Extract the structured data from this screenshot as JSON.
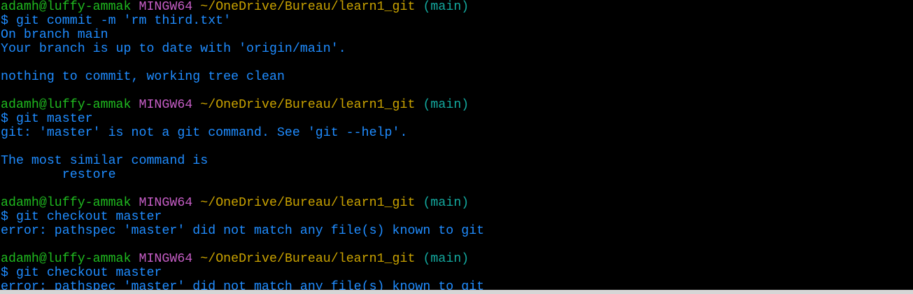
{
  "colors": {
    "green": "#1fb91f",
    "magenta": "#c55dc5",
    "yellow": "#c9a200",
    "cyan": "#13a89e",
    "blue": "#1f8cff",
    "background": "#000000"
  },
  "terminal": {
    "lines": [
      {
        "type": "prompt",
        "segments": [
          {
            "text": "adamh@luffy-ammak",
            "color": "green"
          },
          {
            "text": " "
          },
          {
            "text": "MINGW64",
            "color": "magenta"
          },
          {
            "text": " "
          },
          {
            "text": "~/OneDrive/Bureau/learn1_git",
            "color": "yellow"
          },
          {
            "text": " "
          },
          {
            "text": "(main)",
            "color": "cyan"
          }
        ]
      },
      {
        "type": "command",
        "segments": [
          {
            "text": "$ git commit -m 'rm third.txt'",
            "color": "blue"
          }
        ]
      },
      {
        "type": "output",
        "segments": [
          {
            "text": "On branch main",
            "color": "blue"
          }
        ]
      },
      {
        "type": "output",
        "segments": [
          {
            "text": "Your branch is up to date with 'origin/main'.",
            "color": "blue"
          }
        ]
      },
      {
        "type": "blank",
        "segments": []
      },
      {
        "type": "output",
        "segments": [
          {
            "text": "nothing to commit, working tree clean",
            "color": "blue"
          }
        ]
      },
      {
        "type": "blank",
        "segments": []
      },
      {
        "type": "prompt",
        "segments": [
          {
            "text": "adamh@luffy-ammak",
            "color": "green"
          },
          {
            "text": " "
          },
          {
            "text": "MINGW64",
            "color": "magenta"
          },
          {
            "text": " "
          },
          {
            "text": "~/OneDrive/Bureau/learn1_git",
            "color": "yellow"
          },
          {
            "text": " "
          },
          {
            "text": "(main)",
            "color": "cyan"
          }
        ]
      },
      {
        "type": "command",
        "segments": [
          {
            "text": "$ git master",
            "color": "blue"
          }
        ]
      },
      {
        "type": "output",
        "segments": [
          {
            "text": "git: 'master' is not a git command. See 'git --help'.",
            "color": "blue"
          }
        ]
      },
      {
        "type": "blank",
        "segments": []
      },
      {
        "type": "output",
        "segments": [
          {
            "text": "The most similar command is",
            "color": "blue"
          }
        ]
      },
      {
        "type": "output",
        "segments": [
          {
            "text": "        restore",
            "color": "blue"
          }
        ]
      },
      {
        "type": "blank",
        "segments": []
      },
      {
        "type": "prompt",
        "segments": [
          {
            "text": "adamh@luffy-ammak",
            "color": "green"
          },
          {
            "text": " "
          },
          {
            "text": "MINGW64",
            "color": "magenta"
          },
          {
            "text": " "
          },
          {
            "text": "~/OneDrive/Bureau/learn1_git",
            "color": "yellow"
          },
          {
            "text": " "
          },
          {
            "text": "(main)",
            "color": "cyan"
          }
        ]
      },
      {
        "type": "command",
        "segments": [
          {
            "text": "$ git checkout master",
            "color": "blue"
          }
        ]
      },
      {
        "type": "output",
        "segments": [
          {
            "text": "error: pathspec 'master' did not match any file(s) known to git",
            "color": "blue"
          }
        ]
      },
      {
        "type": "blank",
        "segments": []
      },
      {
        "type": "prompt",
        "segments": [
          {
            "text": "adamh@luffy-ammak",
            "color": "green"
          },
          {
            "text": " "
          },
          {
            "text": "MINGW64",
            "color": "magenta"
          },
          {
            "text": " "
          },
          {
            "text": "~/OneDrive/Bureau/learn1_git",
            "color": "yellow"
          },
          {
            "text": " "
          },
          {
            "text": "(main)",
            "color": "cyan"
          }
        ]
      },
      {
        "type": "command",
        "segments": [
          {
            "text": "$ git checkout master",
            "color": "blue"
          }
        ]
      },
      {
        "type": "output",
        "segments": [
          {
            "text": "error: pathspec 'master' did not match any file(s) known to git",
            "color": "blue"
          }
        ]
      }
    ]
  }
}
